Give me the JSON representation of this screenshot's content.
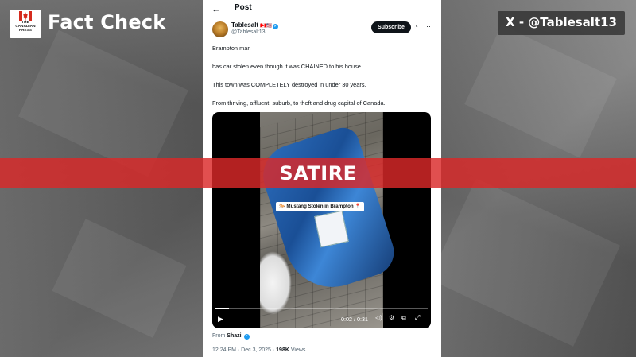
{
  "branding": {
    "logo_line1": "THE",
    "logo_line2": "CANADIAN",
    "logo_line3": "PRESS",
    "title": "Fact Check",
    "source_tag": "X - @Tablesalt13",
    "accent_red": "#db2828"
  },
  "post": {
    "header_title": "Post",
    "back_icon": "arrow-left-icon",
    "author": {
      "display_name": "Tablesalt",
      "flags": "🇨🇦🇺🇸",
      "handle": "@Tablesalt13"
    },
    "subscribe_label": "Subscribe",
    "lines": [
      "Brampton man",
      "has car stolen even though it was CHAINED to his house",
      "This town was COMPLETELY destroyed in under 30 years.",
      "From thriving, affluent, suburb, to theft and drug capital of Canada."
    ],
    "video": {
      "caption": "🐎 Mustang Stolen in Brampton 📍",
      "time_display": "0:02 / 0:31",
      "progress": 0.065
    },
    "from_label": "From",
    "from_name": "Shazi",
    "timestamp": "12:24 PM · Dec 3, 2025 · ",
    "views_count": "198K",
    "views_label": "Views"
  },
  "overlay": {
    "label": "SATIRE"
  }
}
